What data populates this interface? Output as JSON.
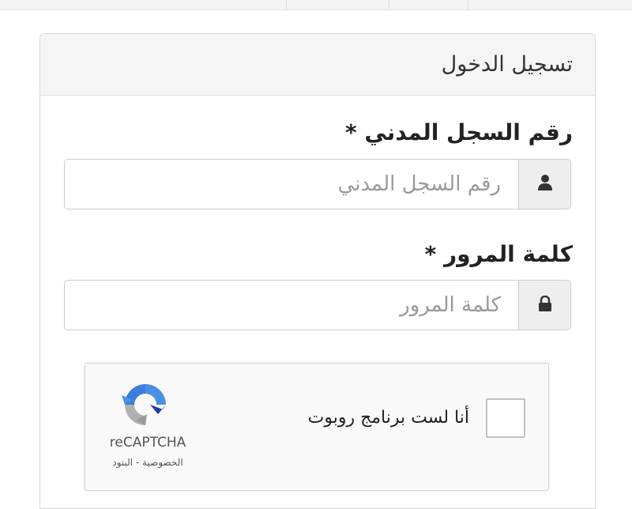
{
  "login": {
    "title": "تسجيل الدخول",
    "civil_id": {
      "label": "رقم السجل المدني *",
      "placeholder": "رقم السجل المدني",
      "icon": "user-icon"
    },
    "password": {
      "label": "كلمة المرور *",
      "placeholder": "كلمة المرور",
      "icon": "lock-icon"
    },
    "recaptcha": {
      "checkbox_label": "أنا لست برنامج روبوت",
      "brand": "reCAPTCHA",
      "links": "الخصوصية - البنود"
    }
  },
  "colors": {
    "header_bg": "#f5f5f5",
    "addon_bg": "#eeeeee",
    "border": "#cccccc",
    "recaptcha_blue": "#4a90e2",
    "recaptcha_grey": "#b0b0b0"
  }
}
